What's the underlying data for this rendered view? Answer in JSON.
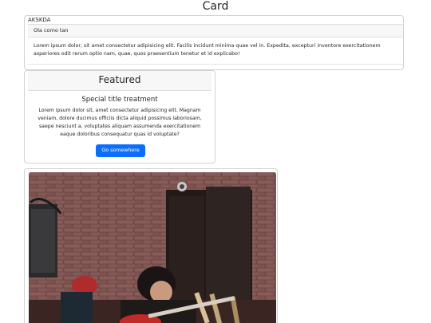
{
  "page": {
    "title": "Card"
  },
  "card1": {
    "title": "AKSKDA",
    "header": "Ola como tan",
    "body": "Lorem ipsum dolor, sit amet consectetur adipisicing elit. Facilis incidunt minima quae vel in. Expedita, excepturi inventore exercitationem asperiores odit rerum optio nam, quae, quos praesentium tenetur et id explicabo!"
  },
  "card2": {
    "header": "Featured",
    "title": "Special title treatment",
    "text": "Lorem ipsum dolor sit, amet consectetur adipisicing elit. Magnam veniam, dolore ducimus officiis dicta aliquid possimus laboriosam, saepe nesciunt a, voluptates aliquam assumenda exercitationem eaque doloribus consequatur quas id voluptate?",
    "button_label": "Go somewhere",
    "button_color": "#0d6efd"
  },
  "card3": {
    "image_subject": "guitarist-photo"
  }
}
